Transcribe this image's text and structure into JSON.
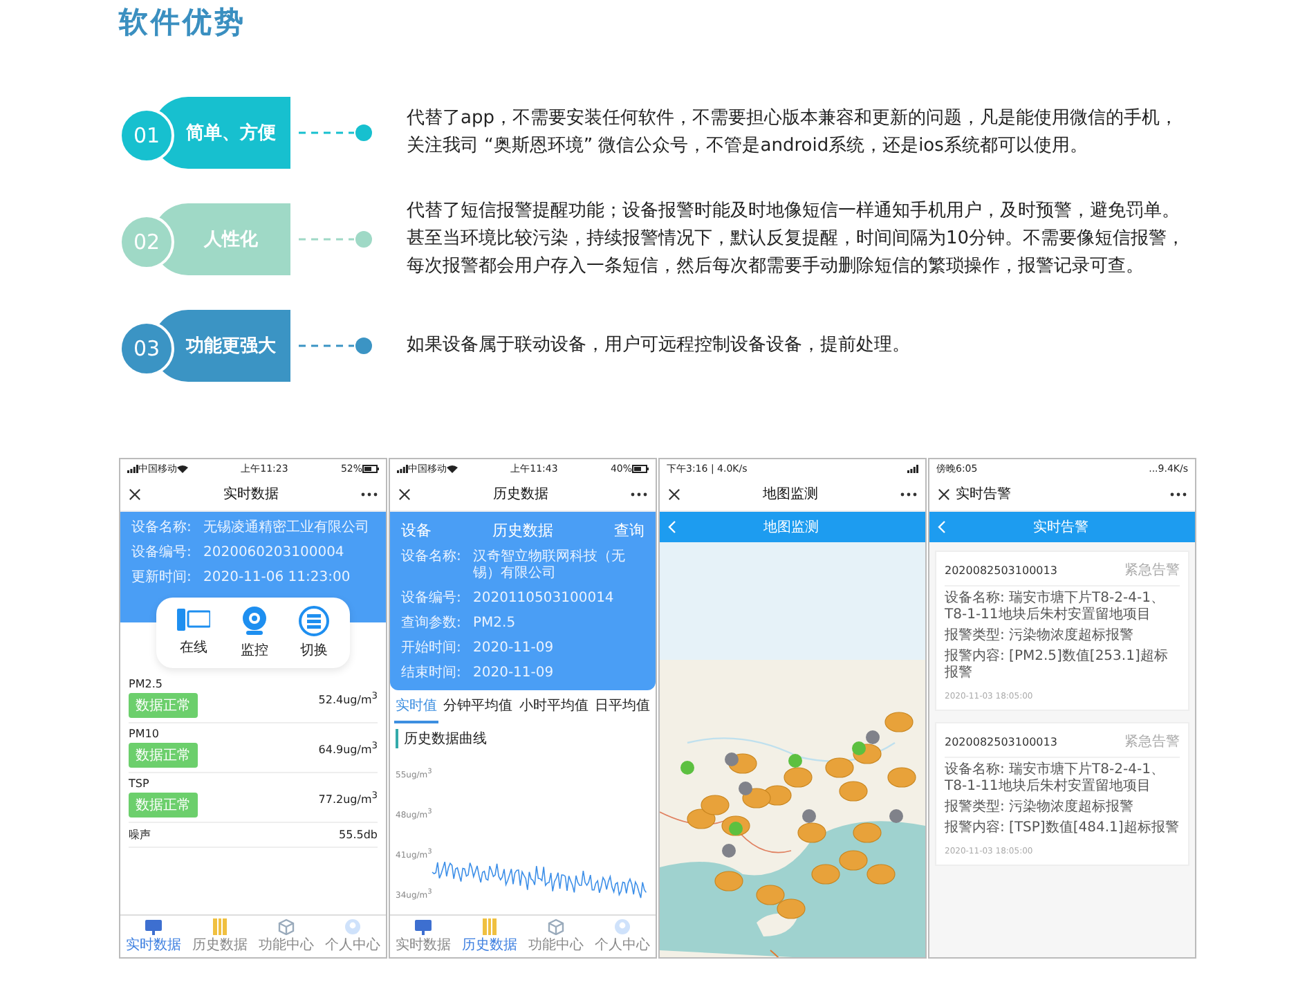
{
  "title": "软件优势",
  "features": [
    {
      "number": "01",
      "label": "简单、方便",
      "color": "#17c0cf",
      "text": "代替了app，不需要安装任何软件，不需要担心版本兼容和更新的问题，凡是能使用微信的手机，关注我司 “奥斯恩环境” 微信公众号，不管是android系统，还是ios系统都可以使用。"
    },
    {
      "number": "02",
      "label": "人性化",
      "color": "#9fd9c6",
      "text": "代替了短信报警提醒功能；设备报警时能及时地像短信一样通知手机用户，及时预警，避免罚单。甚至当环境比较污染，持续报警情况下，默认反复提醒，时间间隔为10分钟。不需要像短信报警，每次报警都会用户存入一条短信，然后每次都需要手动删除短信的繁琐操作，报警记录可查。"
    },
    {
      "number": "03",
      "label": "功能更强大",
      "color": "#3b94c4",
      "text": "如果设备属于联动设备，用户可远程控制设备设备，提前处理。"
    }
  ],
  "realtime_screen": {
    "status_bar": {
      "carrier": "中国移动",
      "time": "上午11:23",
      "battery": "52%"
    },
    "nav_title": "实时数据",
    "info": [
      {
        "label": "设备名称:",
        "value": "无锡凌通精密工业有限公司"
      },
      {
        "label": "设备编号:",
        "value": "2020060203100004"
      },
      {
        "label": "更新时间:",
        "value": "2020-11-06 11:23:00"
      }
    ],
    "actions": [
      {
        "kind": "online",
        "label": "在线"
      },
      {
        "kind": "camera",
        "label": "监控"
      },
      {
        "kind": "switch",
        "label": "切换"
      }
    ],
    "readings": [
      {
        "name": "PM2.5",
        "status": "数据正常",
        "value": "52.4ug/m$^{3}$"
      },
      {
        "name": "PM10",
        "status": "数据正常",
        "value": "64.9ug/m$^{3}$"
      },
      {
        "name": "TSP",
        "status": "数据正常",
        "value": "77.2ug/m$^{3}$"
      },
      {
        "name": "噪声",
        "value": "55.5db"
      }
    ],
    "tabbar": [
      {
        "kind": "realtime",
        "label": "实时数据",
        "selected": true
      },
      {
        "kind": "history",
        "label": "历史数据",
        "selected": false
      },
      {
        "kind": "functions",
        "label": "功能中心",
        "selected": false
      },
      {
        "kind": "profile",
        "label": "个人中心",
        "selected": false
      }
    ]
  },
  "history_screen": {
    "status_bar": {
      "carrier": "中国移动",
      "time": "上午11:43",
      "battery": "40%"
    },
    "nav_title": "历史数据",
    "header": {
      "left": "设备",
      "center": "历史数据",
      "right": "查询"
    },
    "info": [
      {
        "label": "设备名称:",
        "value": "汉奇智立物联网科技（无锡）有限公司"
      },
      {
        "label": "设备编号:",
        "value": "2020110503100014"
      },
      {
        "label": "查询参数:",
        "value": "PM2.5"
      },
      {
        "label": "开始时间:",
        "value": "2020-11-09"
      },
      {
        "label": "结束时间:",
        "value": "2020-11-09"
      }
    ],
    "tabs": [
      {
        "label": "实时值",
        "selected": true
      },
      {
        "label": "分钟平均值",
        "selected": false
      },
      {
        "label": "小时平均值",
        "selected": false
      },
      {
        "label": "日平均值",
        "selected": false
      }
    ],
    "chart_title": "历史数据曲线",
    "y_labels": [
      "55ug/m$^{3}$",
      "48ug/m$^{3}$",
      "41ug/m$^{3}$",
      "34ug/m$^{3}$"
    ],
    "tabbar": [
      {
        "kind": "realtime",
        "label": "实时数据",
        "selected": false
      },
      {
        "kind": "history",
        "label": "历史数据",
        "selected": true
      },
      {
        "kind": "functions",
        "label": "功能中心",
        "selected": false
      },
      {
        "kind": "profile",
        "label": "个人中心",
        "selected": false
      }
    ]
  },
  "map_screen": {
    "status_bar": {
      "time": "下午3:16 | 4.0K/s"
    },
    "nav_title": "地图监测",
    "header_title": "地图监测"
  },
  "alarm_screen": {
    "status_bar": {
      "time": "傍晚6:05",
      "speed": "...9.4K/s"
    },
    "nav_title": "实时告警",
    "header_title": "实时告警",
    "alarms": [
      {
        "id": "2020082503100013",
        "level": "紧急告警",
        "lines": [
          "设备名称: 瑞安市塘下片T8-2-4-1、T8-1-11地块后朱村安置留地项目",
          "报警类型: 污染物浓度超标报警",
          "报警内容: [PM2.5]数值[253.1]超标报警"
        ],
        "time": "2020-11-03 18:05:00"
      },
      {
        "id": "2020082503100013",
        "level": "紧急告警",
        "lines": [
          "设备名称: 瑞安市塘下片T8-2-4-1、T8-1-11地块后朱村安置留地项目",
          "报警类型: 污染物浓度超标报警",
          "报警内容: [TSP]数值[484.1]超标报警"
        ],
        "time": "2020-11-03 18:05:00"
      }
    ]
  }
}
